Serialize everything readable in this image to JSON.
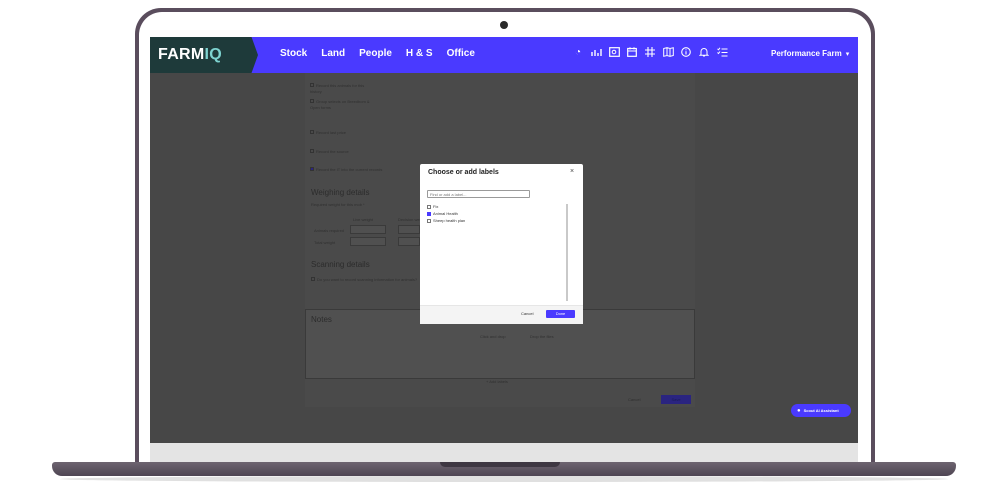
{
  "app": {
    "logo_main": "FARM",
    "logo_accent": "IQ",
    "nav": [
      "Stock",
      "Land",
      "People",
      "H & S",
      "Office"
    ],
    "farm_name": "Performance Farm",
    "toolbar_icons": [
      "speedometer-icon",
      "chart-icon",
      "search-map-icon",
      "calendar-icon",
      "grid-icon",
      "map-icon",
      "info-icon",
      "bell-icon",
      "checklist-icon"
    ],
    "accent_color": "#4a3aff",
    "logo_bg_color": "#1e3a3a"
  },
  "background_page": {
    "lines": [
      "Record this animals for this",
      "history",
      "Group selects on Breedbom &",
      "Open forms",
      "Record last price",
      "Record the source",
      "Record the IT into the current records",
      "Required weight for this mob *",
      "Live weight",
      "Decision weight",
      "Animals required",
      "Total weight",
      "Do you want to record scanning information for animals?",
      "Click and drop",
      "Drop the files",
      "+ Add labels"
    ],
    "headings": [
      "Weighing details",
      "Scanning details",
      "Notes"
    ],
    "cancel_label": "Cancel",
    "save_label": "Save"
  },
  "modal": {
    "title": "Choose or add labels",
    "close_glyph": "×",
    "search_placeholder": "Find or add a label...",
    "options": [
      {
        "label": "Fix",
        "checked": false
      },
      {
        "label": "Animal Health",
        "checked": true
      },
      {
        "label": "Sheep health plan",
        "checked": false
      }
    ],
    "cancel_label": "Cancel",
    "done_label": "Done"
  },
  "assistant": {
    "label": "Scout AI Assistant"
  }
}
